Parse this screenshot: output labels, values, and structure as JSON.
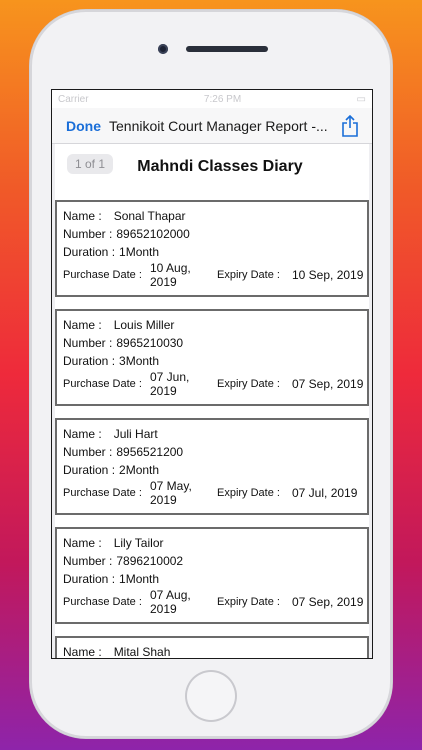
{
  "status": {
    "carrier": "Carrier",
    "time": "7:26 PM"
  },
  "nav": {
    "done_label": "Done",
    "title": "Tennikoit Court Manager Report -..."
  },
  "document": {
    "page_indicator": "1 of 1",
    "title": "Mahndi Classes Diary",
    "labels": {
      "name": "Name :",
      "number": "Number :",
      "duration": "Duration :",
      "purchase": "Purchase Date :",
      "expiry": "Expiry Date :"
    },
    "entries": [
      {
        "name": "Sonal Thapar",
        "number": "89652102000",
        "duration": "1Month",
        "purchase": "10 Aug, 2019",
        "expiry": "10 Sep, 2019"
      },
      {
        "name": "Louis Miller",
        "number": "8965210030",
        "duration": "3Month",
        "purchase": "07 Jun, 2019",
        "expiry": "07 Sep, 2019"
      },
      {
        "name": "Juli Hart",
        "number": "8956521200",
        "duration": "2Month",
        "purchase": "07 May, 2019",
        "expiry": "07 Jul, 2019"
      },
      {
        "name": "Lily Tailor",
        "number": "7896210002",
        "duration": "1Month",
        "purchase": "07 Aug, 2019",
        "expiry": "07 Sep, 2019"
      },
      {
        "name": "Mital Shah",
        "number": "",
        "duration": "",
        "purchase": "",
        "expiry": ""
      }
    ]
  },
  "colors": {
    "accent": "#1a6ed8",
    "card_border": "#6b6b6b"
  },
  "icons": {
    "share": "share-icon"
  }
}
